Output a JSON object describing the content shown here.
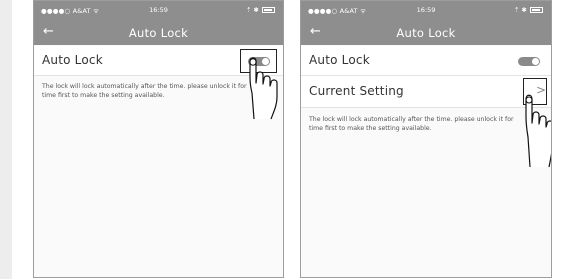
{
  "screens": [
    {
      "status": {
        "carrier": "●●●●○ A&AT ᯤ",
        "time": "16:59",
        "right_icons": "⇡ ✱"
      },
      "nav": {
        "back_icon": "←",
        "title": "Auto Lock"
      },
      "rows": [
        {
          "label": "Auto Lock",
          "toggle": "on"
        }
      ],
      "hint": [
        "The lock will lock automatically after the time. please unlock it for",
        "time first to make the setting available."
      ]
    },
    {
      "status": {
        "carrier": "●●●●○ A&AT ᯤ",
        "time": "16:59",
        "right_icons": "⇡ ✱"
      },
      "nav": {
        "back_icon": "←",
        "title": "Auto Lock"
      },
      "rows": [
        {
          "label": "Auto Lock",
          "toggle": "on"
        },
        {
          "label": "Current Setting",
          "chevron": ">"
        }
      ],
      "hint": [
        "The lock will lock automatically after the time. please unlock it for",
        "time first to make the setting available."
      ]
    }
  ],
  "colors": {
    "bar": "#8e8e8e",
    "toggle": "#8a8a8a",
    "background": "#fafafa"
  },
  "icons": [
    "back-arrow-icon",
    "battery-icon",
    "bluetooth-icon",
    "chevron-right-icon",
    "pointing-hand-icon"
  ]
}
